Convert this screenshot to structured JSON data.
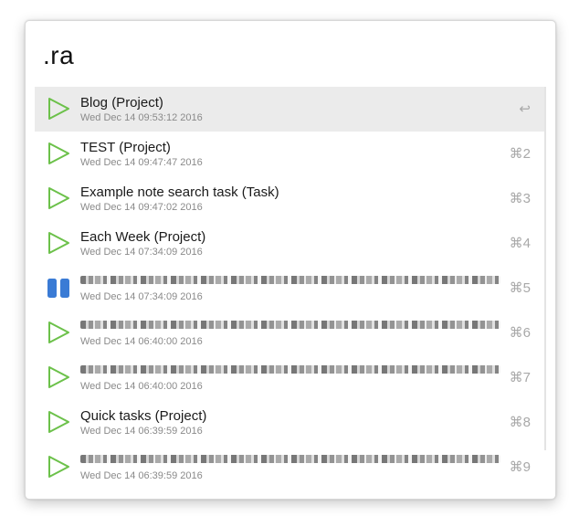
{
  "search": {
    "query": ".ra"
  },
  "results": [
    {
      "title": "Blog (Project)",
      "date": "Wed Dec 14 09:53:12 2016",
      "shortcut": "↩",
      "icon": "play-triangle-icon",
      "selected": true
    },
    {
      "title": "TEST (Project)",
      "date": "Wed Dec 14 09:47:47 2016",
      "shortcut": "⌘2",
      "icon": "play-triangle-icon"
    },
    {
      "title": "Example note search task (Task)",
      "date": "Wed Dec 14 09:47:02 2016",
      "shortcut": "⌘3",
      "icon": "play-triangle-icon"
    },
    {
      "title": "Each Week (Project)",
      "date": "Wed Dec 14 07:34:09 2016",
      "shortcut": "⌘4",
      "icon": "play-triangle-icon"
    },
    {
      "title": "",
      "date": "Wed Dec 14 07:34:09 2016",
      "shortcut": "⌘5",
      "icon": "pause-icon",
      "blurred": true
    },
    {
      "title": "",
      "date": "Wed Dec 14 06:40:00 2016",
      "shortcut": "⌘6",
      "icon": "play-triangle-icon",
      "blurred": true
    },
    {
      "title": "",
      "date": "Wed Dec 14 06:40:00 2016",
      "shortcut": "⌘7",
      "icon": "play-triangle-icon",
      "blurred": true
    },
    {
      "title": "Quick tasks (Project)",
      "date": "Wed Dec 14 06:39:59 2016",
      "shortcut": "⌘8",
      "icon": "play-triangle-icon"
    },
    {
      "title": "",
      "date": "Wed Dec 14 06:39:59 2016",
      "shortcut": "⌘9",
      "icon": "play-triangle-icon",
      "blurred": true
    }
  ],
  "colors": {
    "play": "#6cc14a",
    "pause": "#3a7bd5",
    "selection": "#ebebeb"
  }
}
